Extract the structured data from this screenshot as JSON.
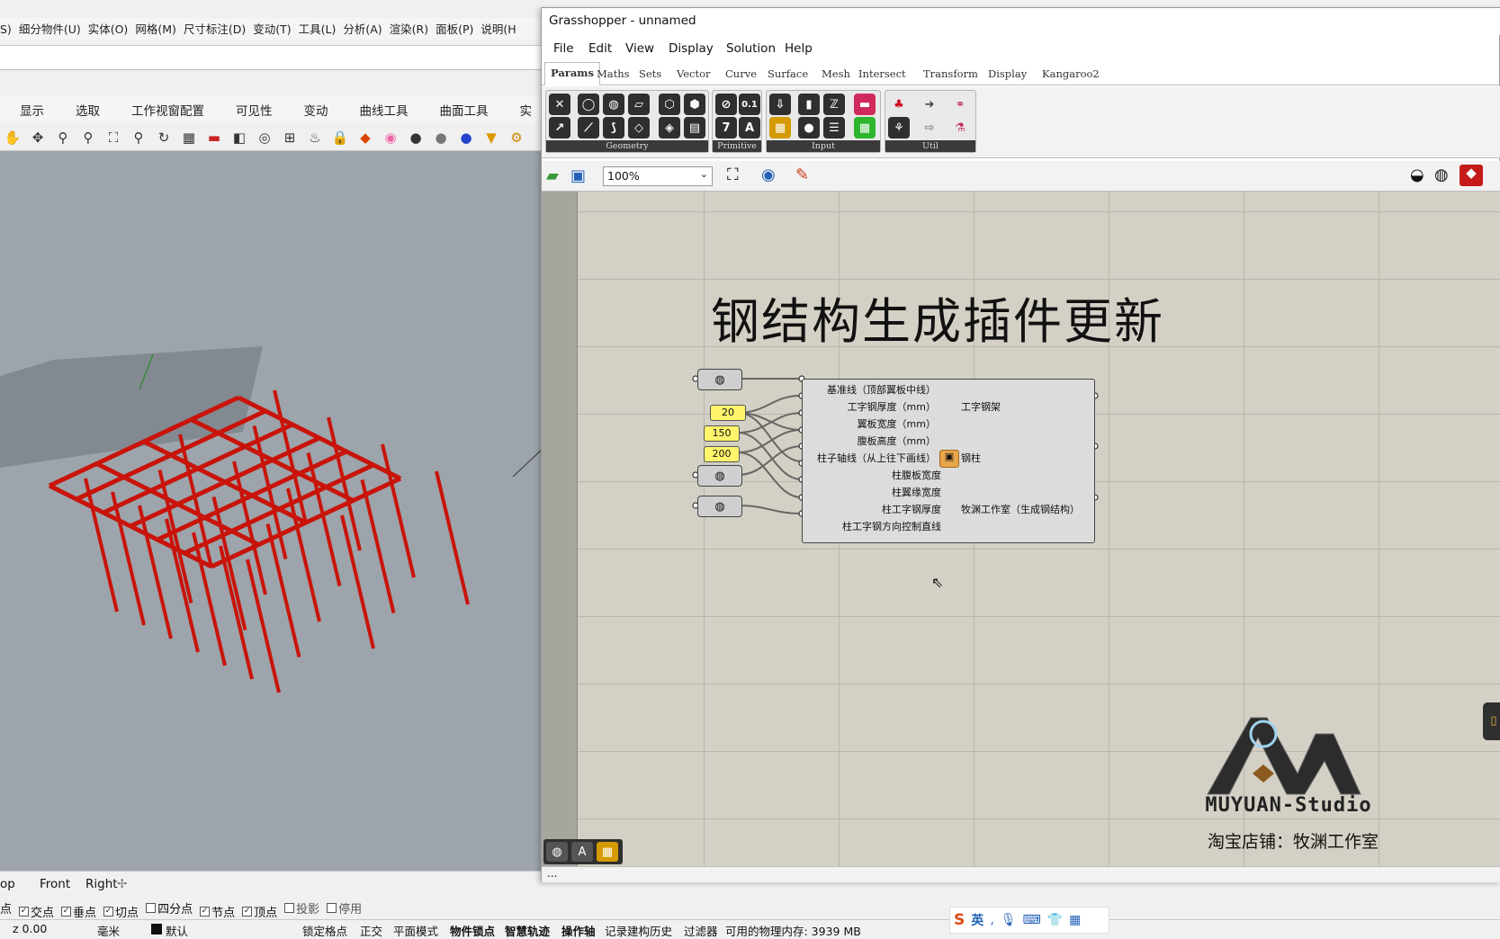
{
  "rhino": {
    "menubar": [
      "S)",
      "细分物件(U)",
      "实体(O)",
      "网格(M)",
      "尺寸标注(D)",
      "变动(T)",
      "工具(L)",
      "分析(A)",
      "渲染(R)",
      "面板(P)",
      "说明(H"
    ],
    "tabs": [
      "显示",
      "选取",
      "工作视窗配置",
      "可见性",
      "变动",
      "曲线工具",
      "曲面工具",
      "实"
    ],
    "view_tabs": [
      "op",
      "Front",
      "Right"
    ],
    "osnaps": [
      {
        "label": "点",
        "checked": true
      },
      {
        "label": "交点",
        "checked": true
      },
      {
        "label": "垂点",
        "checked": true
      },
      {
        "label": "切点",
        "checked": true
      },
      {
        "label": "四分点",
        "checked": false
      },
      {
        "label": "节点",
        "checked": true
      },
      {
        "label": "顶点",
        "checked": true
      },
      {
        "label": "投影",
        "checked": false
      },
      {
        "label": "停用",
        "checked": false
      }
    ],
    "status": {
      "z": "z 0.00",
      "units": "毫米",
      "layer": "默认",
      "toggles": [
        "锁定格点",
        "正交",
        "平面模式",
        "物件锁点",
        "智慧轨迹",
        "操作轴",
        "记录建构历史",
        "过滤器"
      ],
      "memory": "可用的物理内存: 3939 MB"
    }
  },
  "gh": {
    "title": "Grasshopper - unnamed",
    "menu": [
      "File",
      "Edit",
      "View",
      "Display",
      "Solution",
      "Help"
    ],
    "categories": [
      "Params",
      "Maths",
      "Sets",
      "Vector",
      "Curve",
      "Surface",
      "Mesh",
      "Intersect",
      "Transform",
      "Display",
      "Kangaroo2"
    ],
    "active_category": "Params",
    "panels": [
      "Geometry",
      "Primitive",
      "Input",
      "Util"
    ],
    "zoom": "100%",
    "canvas_title": "钢结构生成插件更新",
    "sliders": [
      "20",
      "150",
      "200"
    ],
    "component": {
      "inputs": [
        "基准线（顶部翼板中线）",
        "工字钢厚度（mm）",
        "翼板宽度（mm）",
        "腹板高度（mm）",
        "柱子轴线（从上往下画线）",
        "柱腹板宽度",
        "柱翼缘宽度",
        "柱工字钢厚度",
        "柱工字钢方向控制直线"
      ],
      "outputs": [
        "工字钢架",
        "钢柱",
        "牧渊工作室（生成钢结构）"
      ]
    },
    "logo_text": "MUYUAN-Studio",
    "shop_text": "淘宝店铺：牧渊工作室",
    "status": "..."
  },
  "ime": {
    "label": "英"
  },
  "colors": {
    "canvas": "#d4d0c5",
    "slider": "#fff46c",
    "beam": "#c8140a",
    "viewport": "#9da4ab"
  }
}
